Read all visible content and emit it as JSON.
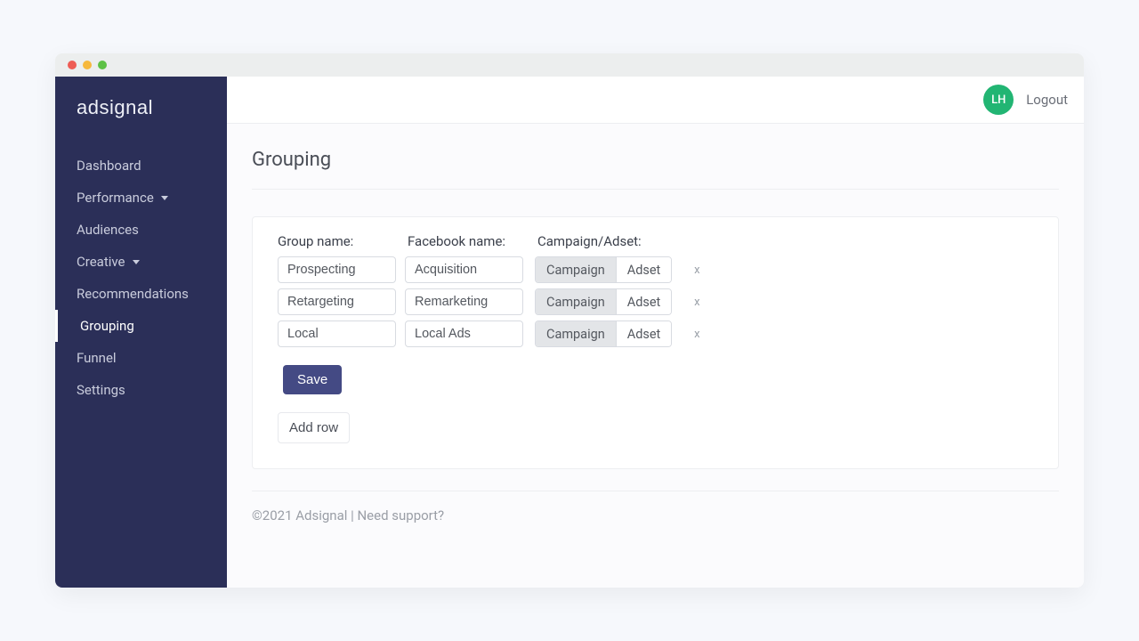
{
  "brand": "adsignal",
  "sidebar": {
    "items": [
      {
        "label": "Dashboard",
        "has_caret": false,
        "active": false
      },
      {
        "label": "Performance",
        "has_caret": true,
        "active": false
      },
      {
        "label": "Audiences",
        "has_caret": false,
        "active": false
      },
      {
        "label": "Creative",
        "has_caret": true,
        "active": false
      },
      {
        "label": "Recommendations",
        "has_caret": false,
        "active": false
      },
      {
        "label": "Grouping",
        "has_caret": false,
        "active": true
      },
      {
        "label": "Funnel",
        "has_caret": false,
        "active": false
      },
      {
        "label": "Settings",
        "has_caret": false,
        "active": false
      }
    ]
  },
  "topbar": {
    "avatar_initials": "LH",
    "logout_label": "Logout"
  },
  "page": {
    "title": "Grouping",
    "columns": {
      "group_name": "Group name:",
      "facebook_name": "Facebook name:",
      "campaign_adset": "Campaign/Adset:"
    },
    "toggle_options": {
      "campaign": "Campaign",
      "adset": "Adset"
    },
    "rows": [
      {
        "group_name": "Prospecting",
        "facebook_name": "Acquisition",
        "selected": "Campaign"
      },
      {
        "group_name": "Retargeting",
        "facebook_name": "Remarketing",
        "selected": "Campaign"
      },
      {
        "group_name": "Local",
        "facebook_name": "Local Ads",
        "selected": "Campaign"
      }
    ],
    "delete_glyph": "x",
    "save_label": "Save",
    "add_row_label": "Add row"
  },
  "footer": {
    "copyright": "©2021 Adsignal",
    "separator": " | ",
    "support": "Need support?"
  }
}
